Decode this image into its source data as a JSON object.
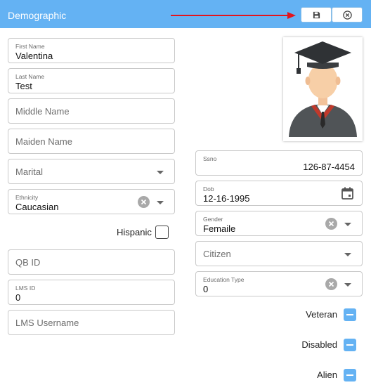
{
  "header": {
    "title": "Demographic"
  },
  "colors": {
    "accent": "#64b2f3",
    "arrow": "#e3141d"
  },
  "left_fields": {
    "first_name": {
      "label": "First Name",
      "value": "Valentina"
    },
    "last_name": {
      "label": "Last Name",
      "value": "Test"
    },
    "middle_name": {
      "placeholder": "Middle Name"
    },
    "maiden_name": {
      "placeholder": "Maiden Name"
    },
    "marital": {
      "placeholder": "Marital"
    },
    "ethnicity": {
      "label": "Ethnicity",
      "value": "Caucasian"
    },
    "hispanic": {
      "label": "Hispanic",
      "checked": false
    },
    "qb_id": {
      "placeholder": "QB ID"
    },
    "lms_id": {
      "label": "LMS ID",
      "value": "0"
    },
    "lms_username": {
      "placeholder": "LMS Username"
    }
  },
  "right_fields": {
    "ssno": {
      "label": "Ssno",
      "value": "126-87-4454"
    },
    "dob": {
      "label": "Dob",
      "value": "12-16-1995"
    },
    "gender": {
      "label": "Gender",
      "value": "Femaile"
    },
    "citizen": {
      "placeholder": "Citizen"
    },
    "education_type": {
      "label": "Education Type",
      "value": "0"
    }
  },
  "toggles": [
    {
      "label": "Veteran"
    },
    {
      "label": "Disabled"
    },
    {
      "label": "Alien"
    }
  ],
  "icons": [
    "save-icon",
    "close-icon",
    "calendar-icon",
    "graduate-avatar",
    "caret-down-icon",
    "clear-icon"
  ]
}
